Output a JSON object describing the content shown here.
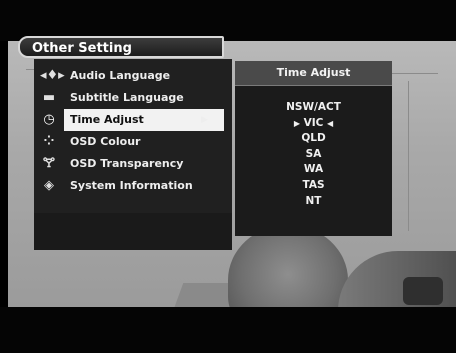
{
  "settings_menu": {
    "title": "Other Setting",
    "items": [
      {
        "label": "Audio Language",
        "icon": "audio-language-icon",
        "glyph": "◂♦▸"
      },
      {
        "label": "Subtitle Language",
        "icon": "subtitle-icon",
        "glyph": "▬"
      },
      {
        "label": "Time Adjust",
        "icon": "clock-icon",
        "glyph": "◷",
        "selected": true,
        "submenu_arrow": "▶"
      },
      {
        "label": "OSD Colour",
        "icon": "osd-colour-icon",
        "glyph": "⁘"
      },
      {
        "label": "OSD Transparency",
        "icon": "osd-transparency-icon",
        "glyph": "🝖"
      },
      {
        "label": "System Information",
        "icon": "system-information-icon",
        "glyph": "◈"
      }
    ]
  },
  "time_adjust": {
    "title": "Time Adjust",
    "selected_region": "VIC",
    "regions": [
      "NSW/ACT",
      "VIC",
      "QLD",
      "SA",
      "WA",
      "TAS",
      "NT"
    ],
    "left_marker": "▶",
    "right_marker": "◀"
  }
}
